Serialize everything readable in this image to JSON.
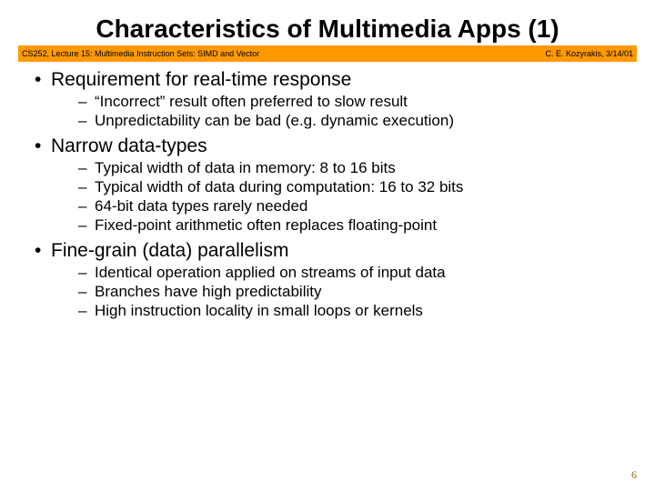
{
  "title": "Characteristics of Multimedia Apps (1)",
  "banner": {
    "left": "CS252, Lecture 15: Multimedia Instruction Sets: SIMD and Vector",
    "right": "C. E. Kozyrakis, 3/14/01"
  },
  "bullets": [
    {
      "text": "Requirement for real-time response",
      "sub": [
        "“Incorrect” result often preferred to slow result",
        "Unpredictability can be bad (e.g. dynamic execution)"
      ]
    },
    {
      "text": "Narrow data-types",
      "sub": [
        "Typical width of data in memory: 8 to 16 bits",
        "Typical width of data during computation: 16 to 32 bits",
        "64-bit data types rarely needed",
        "Fixed-point arithmetic often replaces floating-point"
      ]
    },
    {
      "text": "Fine-grain (data) parallelism",
      "sub": [
        "Identical operation applied on streams of input data",
        "Branches have high predictability",
        "High instruction locality in small loops or kernels"
      ]
    }
  ],
  "page_number": "6"
}
